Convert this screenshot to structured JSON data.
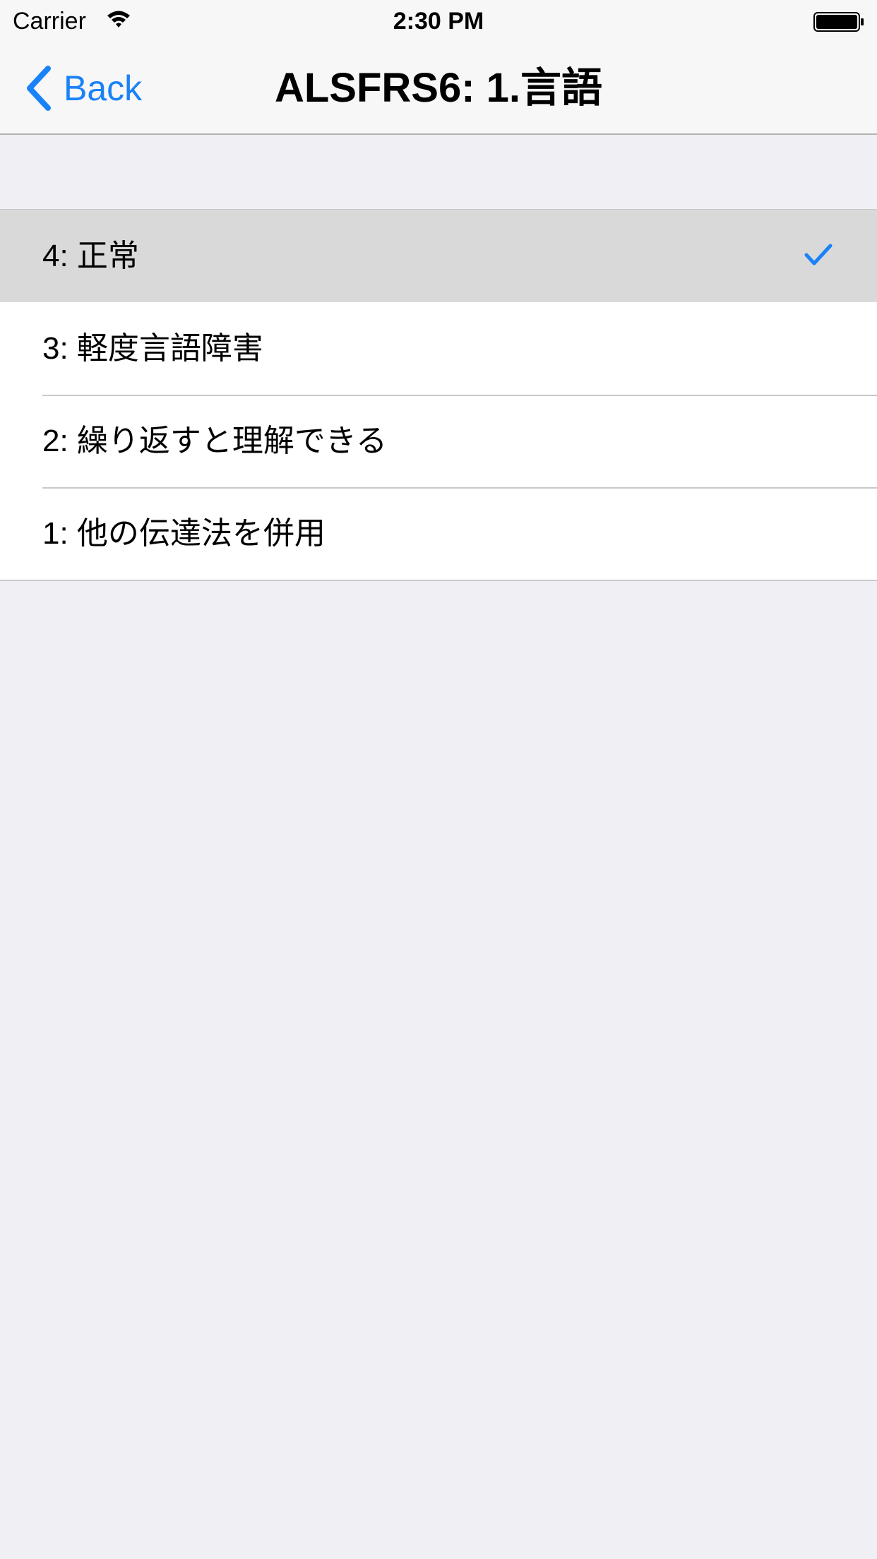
{
  "status_bar": {
    "carrier": "Carrier",
    "time": "2:30 PM",
    "wifi_icon": "wifi-icon",
    "battery_icon": "battery-icon"
  },
  "nav": {
    "back_label": "Back",
    "back_icon": "chevron-left-icon",
    "title": "ALSFRS6: 1.言語"
  },
  "list": {
    "items": [
      {
        "label": "4: 正常",
        "selected": true
      },
      {
        "label": "3: 軽度言語障害",
        "selected": false
      },
      {
        "label": "2: 繰り返すと理解できる",
        "selected": false
      },
      {
        "label": "1: 他の伝達法を併用",
        "selected": false
      }
    ],
    "check_icon": "checkmark-icon"
  },
  "colors": {
    "accent": "#1a82f7",
    "background": "#efeff4",
    "bar": "#f7f7f7",
    "selected_row": "#d9d9d9",
    "separator": "#c8c7cc"
  }
}
